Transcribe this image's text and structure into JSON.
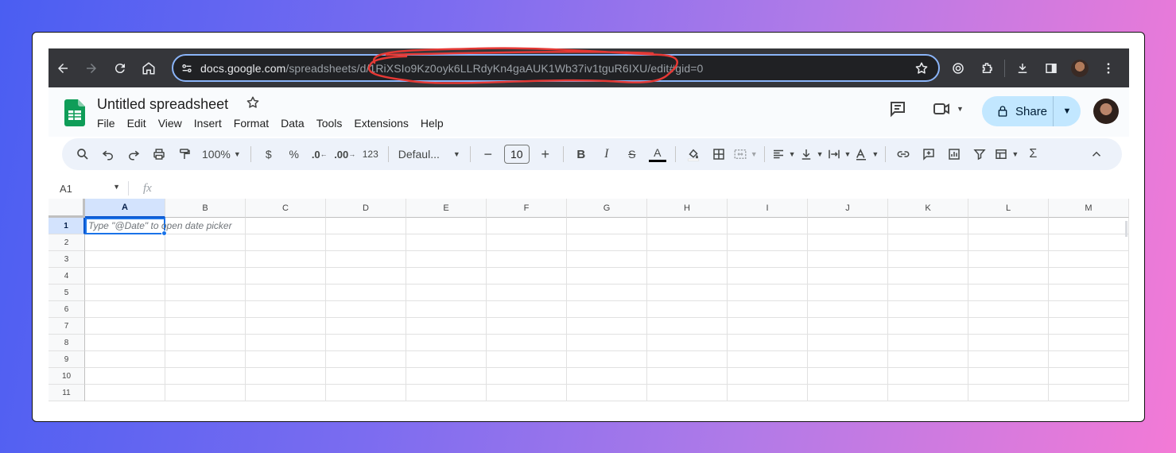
{
  "browser": {
    "url_host": "docs.google.com",
    "url_path": "/spreadsheets/d/1RiXSIo9Kz0oyk6LLRdyKn4gaAUK1Wb37iv1tguR6IXU/edit#gid=0"
  },
  "app": {
    "title": "Untitled spreadsheet",
    "menu": [
      "File",
      "Edit",
      "View",
      "Insert",
      "Format",
      "Data",
      "Tools",
      "Extensions",
      "Help"
    ],
    "share_label": "Share"
  },
  "toolbar": {
    "zoom": "100%",
    "currency": "$",
    "percent": "%",
    "dec_decrease": ".0",
    "dec_increase": ".00",
    "number_format": "123",
    "font": "Defaul...",
    "font_size": "10",
    "bold": "B",
    "italic": "I",
    "strike": "S",
    "text_color": "A",
    "sigma": "Σ"
  },
  "formula_bar": {
    "name_box": "A1",
    "fx": "fx"
  },
  "grid": {
    "columns": [
      "A",
      "B",
      "C",
      "D",
      "E",
      "F",
      "G",
      "H",
      "I",
      "J",
      "K",
      "L",
      "M"
    ],
    "rows": [
      "1",
      "2",
      "3",
      "4",
      "5",
      "6",
      "7",
      "8",
      "9",
      "10",
      "11"
    ],
    "active_cell_hint": "Type \"@Date\" to open date picker"
  },
  "colors": {
    "accent": "#1a73e8",
    "share_bg": "#c2e7ff",
    "annotation": "#e53935"
  }
}
